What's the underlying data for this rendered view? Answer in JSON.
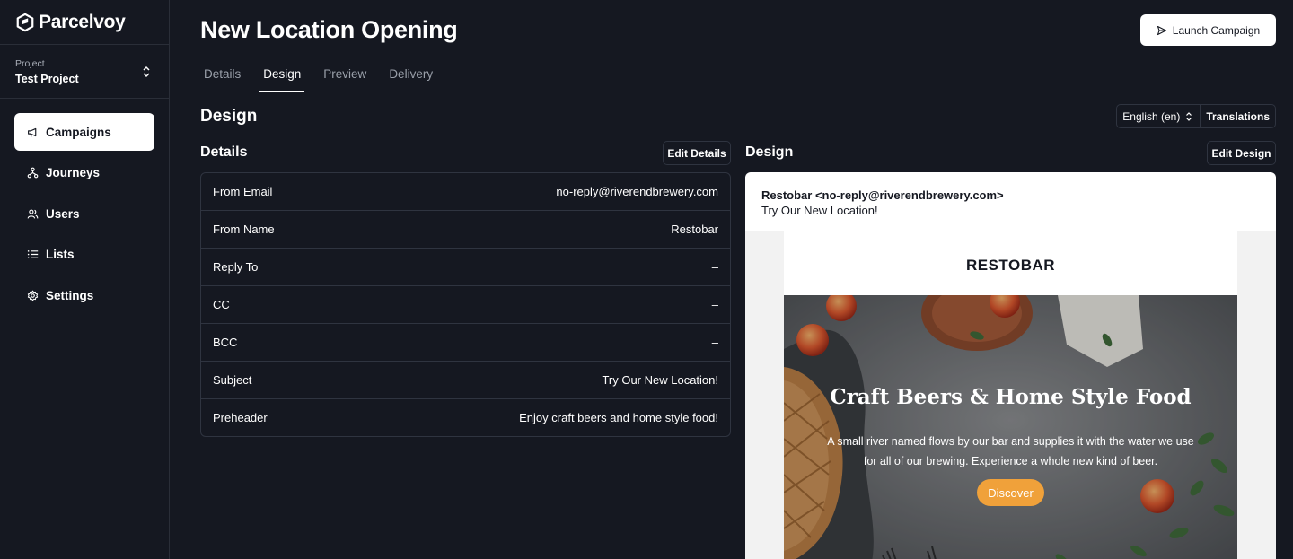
{
  "brand": {
    "name": "Parcelvoy"
  },
  "project": {
    "label": "Project",
    "name": "Test Project"
  },
  "nav": {
    "items": [
      {
        "label": "Campaigns",
        "icon": "megaphone-icon",
        "active": true
      },
      {
        "label": "Journeys",
        "icon": "journeys-icon",
        "active": false
      },
      {
        "label": "Users",
        "icon": "users-icon",
        "active": false
      },
      {
        "label": "Lists",
        "icon": "list-icon",
        "active": false
      },
      {
        "label": "Settings",
        "icon": "gear-icon",
        "active": false
      }
    ]
  },
  "page": {
    "title": "New Location Opening",
    "launch_label": "Launch Campaign",
    "tabs": [
      {
        "label": "Details",
        "active": false
      },
      {
        "label": "Design",
        "active": true
      },
      {
        "label": "Preview",
        "active": false
      },
      {
        "label": "Delivery",
        "active": false
      }
    ],
    "section_title": "Design",
    "language": "English (en)",
    "translations_label": "Translations"
  },
  "details": {
    "title": "Details",
    "edit_label": "Edit Details",
    "rows": [
      {
        "key": "From Email",
        "value": "no-reply@riverendbrewery.com"
      },
      {
        "key": "From Name",
        "value": "Restobar"
      },
      {
        "key": "Reply To",
        "value": "–"
      },
      {
        "key": "CC",
        "value": "–"
      },
      {
        "key": "BCC",
        "value": "–"
      },
      {
        "key": "Subject",
        "value": "Try Our New Location!"
      },
      {
        "key": "Preheader",
        "value": "Enjoy craft beers and home style food!"
      }
    ]
  },
  "design": {
    "title": "Design",
    "edit_label": "Edit Design",
    "email": {
      "from": "Restobar <no-reply@riverendbrewery.com>",
      "subject": "Try Our New Location!",
      "brand": "RESTOBAR",
      "heading": "Craft Beers & Home Style Food",
      "text": "A small river named flows by our bar and supplies it with the water we use for all of our brewing. Experience a whole new kind of beer.",
      "cta": "Discover"
    }
  },
  "colors": {
    "background": "#151821",
    "border": "#2f3440",
    "accent_button": "#f0a13a"
  }
}
